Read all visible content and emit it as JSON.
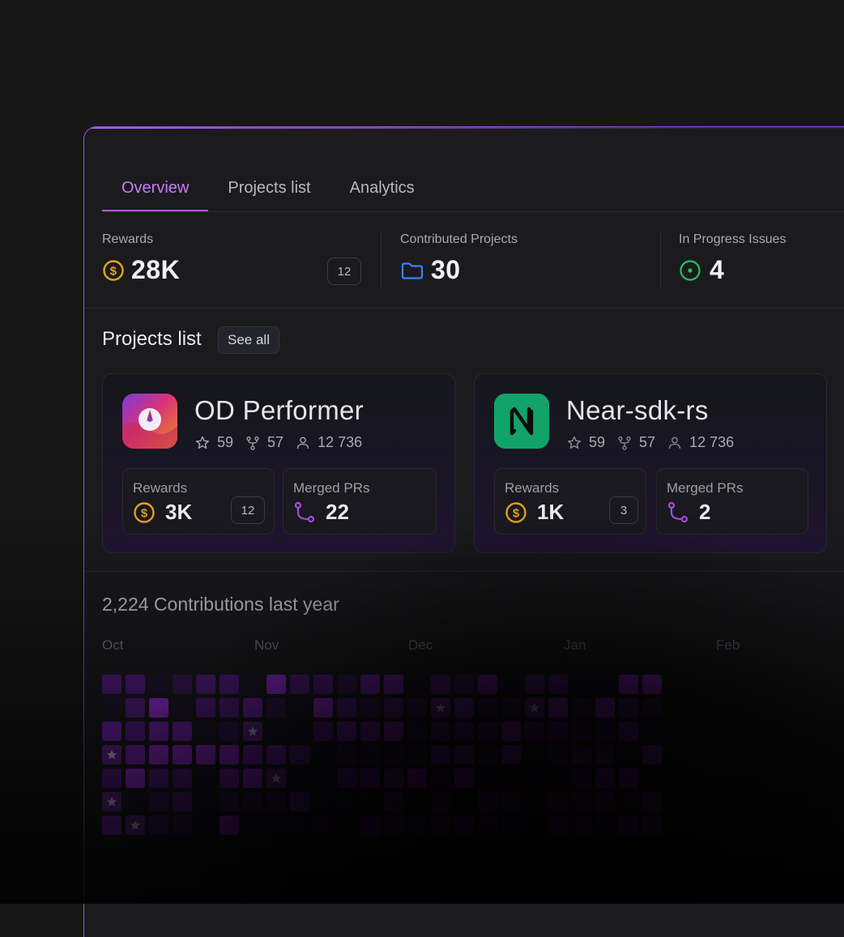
{
  "tabs": [
    {
      "label": "Overview",
      "active": true
    },
    {
      "label": "Projects list",
      "active": false
    },
    {
      "label": "Analytics",
      "active": false
    }
  ],
  "stats": {
    "rewards": {
      "label": "Rewards",
      "value": "28K",
      "badge": "12",
      "icon": "dollar-coin-icon"
    },
    "contributed": {
      "label": "Contributed Projects",
      "value": "30",
      "icon": "folder-icon"
    },
    "in_progress": {
      "label": "In Progress Issues",
      "value": "4",
      "icon": "progress-dot-icon"
    }
  },
  "projects_section": {
    "title": "Projects list",
    "see_all": "See all"
  },
  "projects": [
    {
      "name": "OD Performer",
      "stars": "59",
      "forks": "57",
      "contributors": "12 736",
      "rewards_label": "Rewards",
      "rewards_value": "3K",
      "rewards_badge": "12",
      "merged_label": "Merged PRs",
      "merged_value": "22"
    },
    {
      "name": "Near-sdk-rs",
      "stars": "59",
      "forks": "57",
      "contributors": "12 736",
      "rewards_label": "Rewards",
      "rewards_value": "1K",
      "rewards_badge": "3",
      "merged_label": "Merged PRs",
      "merged_value": "2"
    }
  ],
  "contributions": {
    "title": "2,224 Contributions last year",
    "months": [
      "Oct",
      "Nov",
      "Dec",
      "Jan",
      "Feb"
    ]
  },
  "colors": {
    "accent": "#b35cf0",
    "coin": "#e3a21a",
    "folder": "#3b82f6",
    "progress": "#22c55e",
    "near_logo_bg": "#12a36b"
  }
}
